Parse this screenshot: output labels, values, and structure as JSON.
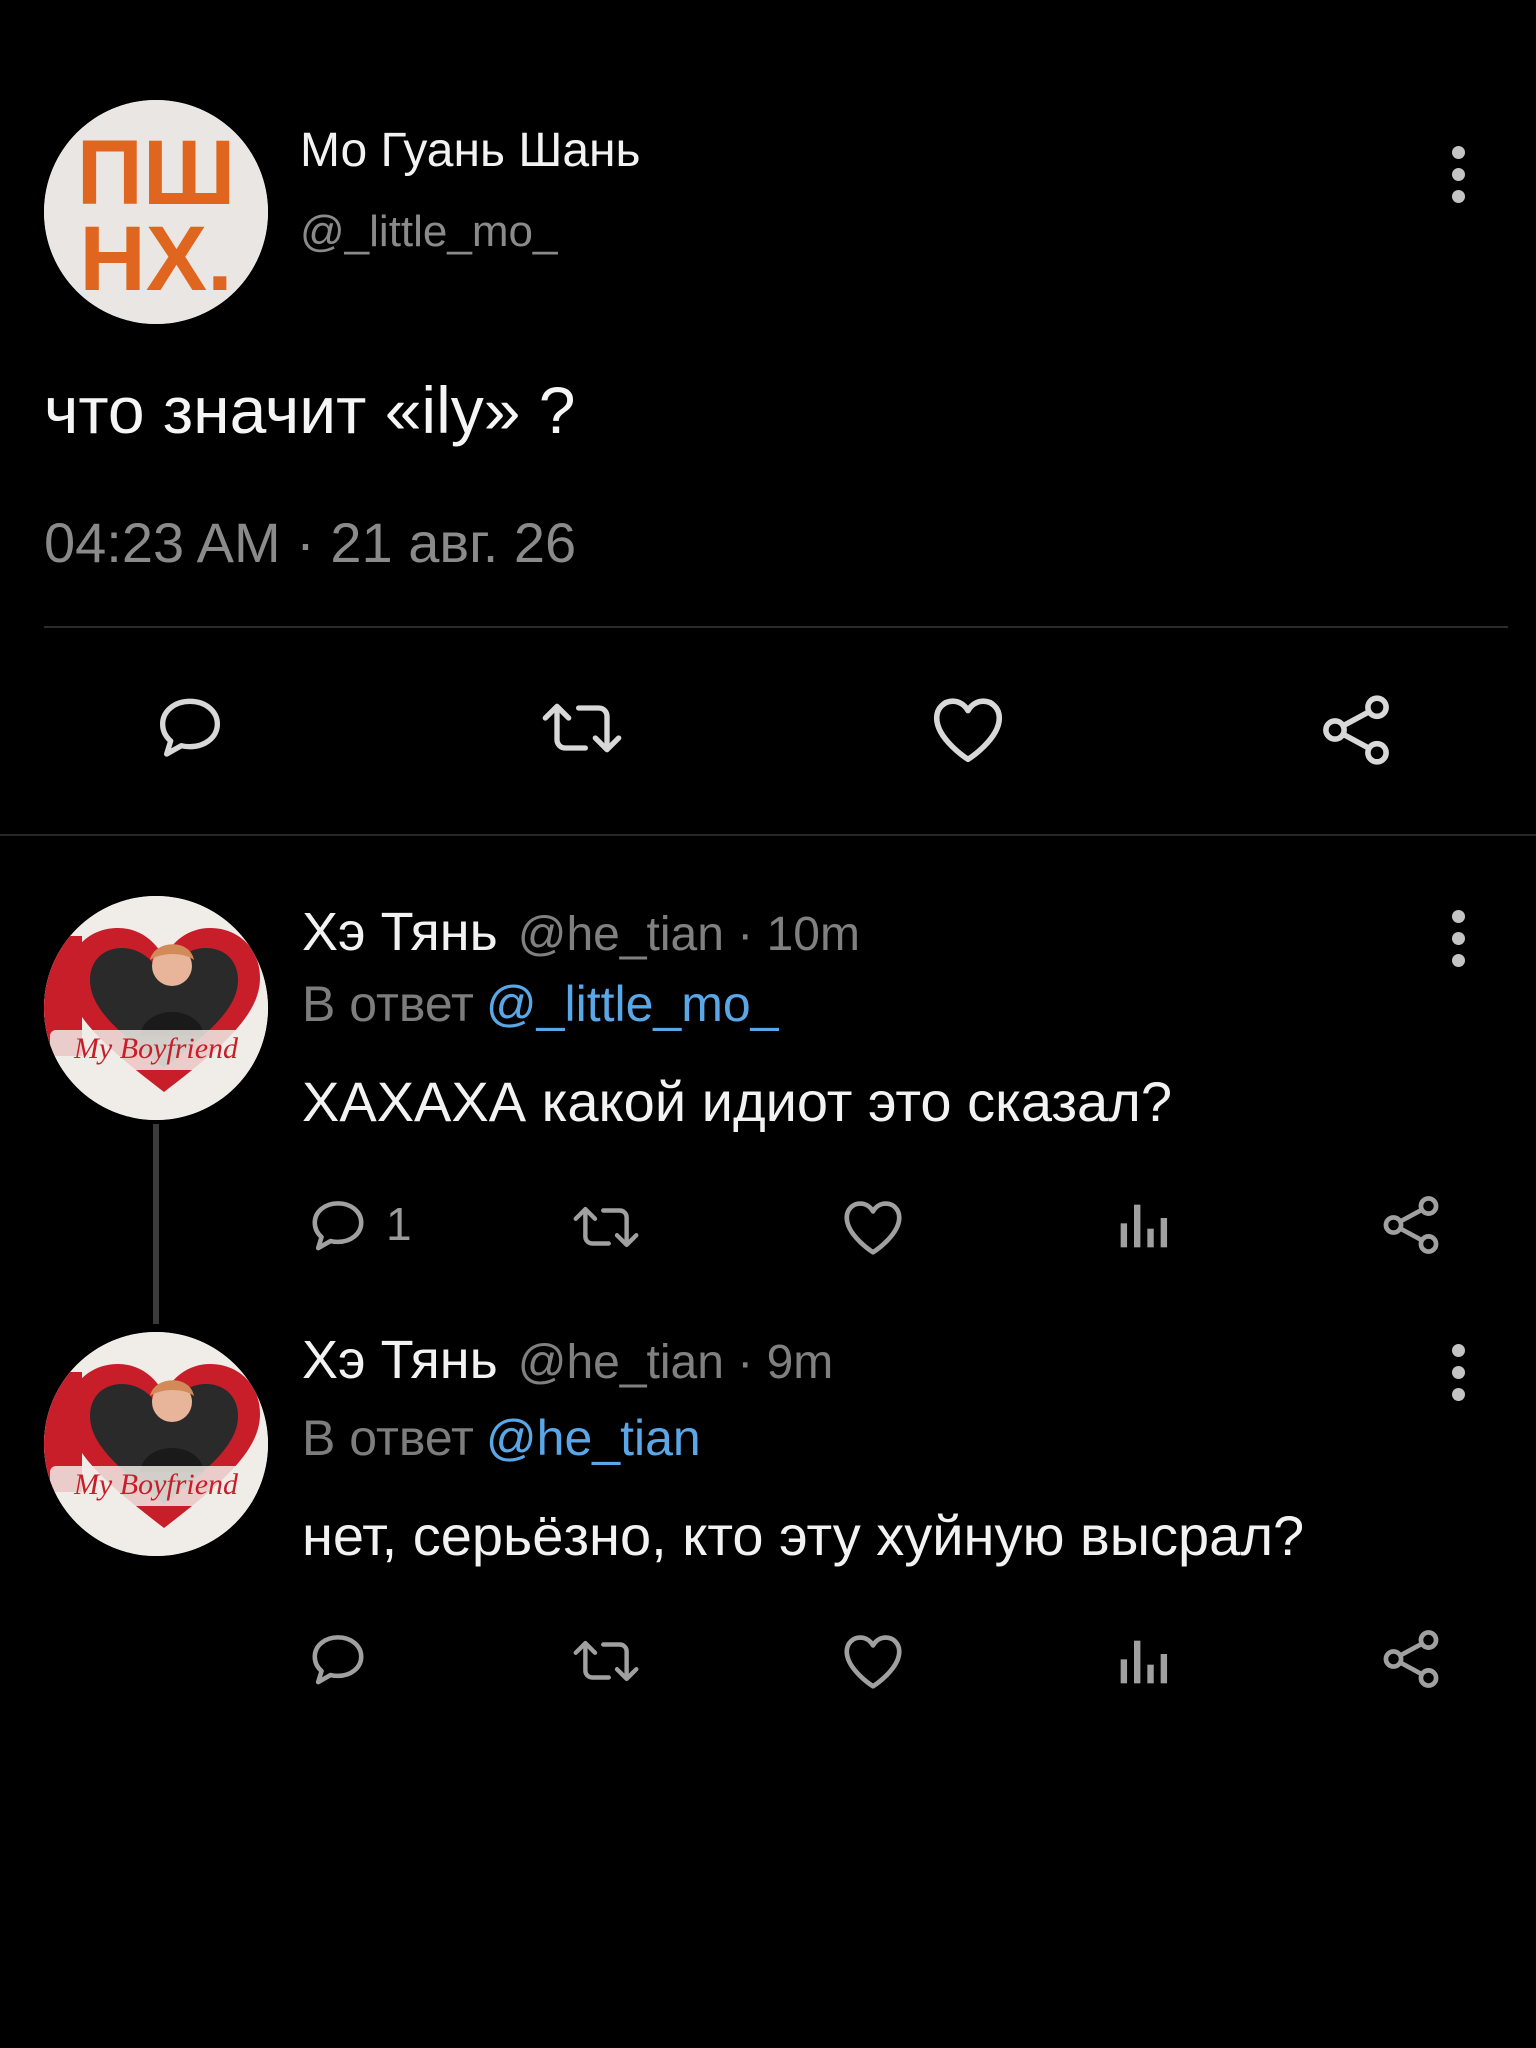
{
  "main_tweet": {
    "author_name": "Мо Гуань Шань",
    "author_handle": "@_little_mo_",
    "avatar_text_top": "ПШ",
    "avatar_text_bottom": "НХ.",
    "text": "что значит «ily» ?",
    "timestamp": "04:23 AM · 21 авг. 26",
    "actions": [
      "comment-icon",
      "retweet-icon",
      "heart-icon",
      "share-icon"
    ]
  },
  "replies": [
    {
      "author_name": "Хэ Тянь",
      "meta": "@he_tian · 10m",
      "reply_label": "В ответ",
      "reply_mention": "@_little_mo_",
      "text": "ХАХАХА какой идиот это сказал?",
      "comment_count": "1",
      "avatar_caption": "My Boyfriend",
      "actions": [
        "comment-icon",
        "retweet-icon",
        "heart-icon",
        "views-icon",
        "share-icon"
      ]
    },
    {
      "author_name": "Хэ Тянь",
      "meta": "@he_tian · 9m",
      "reply_label": "В ответ",
      "reply_mention": "@he_tian",
      "text": "нет, серьёзно, кто эту хуйную высрал?",
      "comment_count": "",
      "avatar_caption": "My Boyfriend",
      "actions": [
        "comment-icon",
        "retweet-icon",
        "heart-icon",
        "views-icon",
        "share-icon"
      ]
    }
  ],
  "colors": {
    "background": "#000000",
    "text_primary": "#f2f2f2",
    "text_secondary": "#8a8a8a",
    "mention": "#5aa7e8",
    "avatar_logo_orange": "#e0661f",
    "avatar_heart_red": "#c81e2a"
  }
}
